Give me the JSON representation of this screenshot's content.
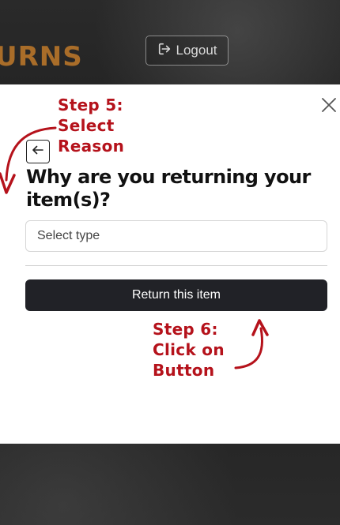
{
  "background": {
    "brand_fragment": "URNS",
    "logout_label": "Logout"
  },
  "modal": {
    "heading": "Why are you returning your item(s)?",
    "select": {
      "placeholder": "Select type"
    },
    "submit_label": "Return this item"
  },
  "annotations": {
    "step5": "Step 5:\nSelect\nReason",
    "step6": "Step 6:\nClick on\nButton"
  },
  "colors": {
    "accent": "#b5121b",
    "button_dark": "#212227",
    "brand": "#b8752a"
  },
  "icons": {
    "logout": "logout-icon",
    "close": "close-icon",
    "back": "arrow-left-icon"
  }
}
